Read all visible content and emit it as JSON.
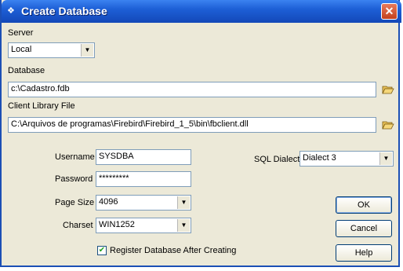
{
  "window": {
    "title": "Create Database",
    "close_glyph": "✕"
  },
  "server": {
    "label": "Server",
    "value": "Local"
  },
  "database": {
    "label": "Database",
    "value": "c:\\Cadastro.fdb"
  },
  "client_library": {
    "label": "Client Library File",
    "value": "C:\\Arquivos de programas\\Firebird\\Firebird_1_5\\bin\\fbclient.dll"
  },
  "username": {
    "label": "Username",
    "value": "SYSDBA"
  },
  "password": {
    "label": "Password",
    "value": "*********"
  },
  "page_size": {
    "label": "Page Size",
    "value": "4096"
  },
  "charset": {
    "label": "Charset",
    "value": "WIN1252"
  },
  "sql_dialect": {
    "label": "SQL Dialect",
    "value": "Dialect 3"
  },
  "register_checkbox": {
    "label": "Register Database After Creating",
    "checked": true
  },
  "buttons": {
    "ok": "OK",
    "cancel": "Cancel",
    "help": "Help"
  },
  "icons": {
    "title": "database-icon",
    "folder": "open-folder-icon",
    "dropdown": "chevron-down-icon"
  }
}
